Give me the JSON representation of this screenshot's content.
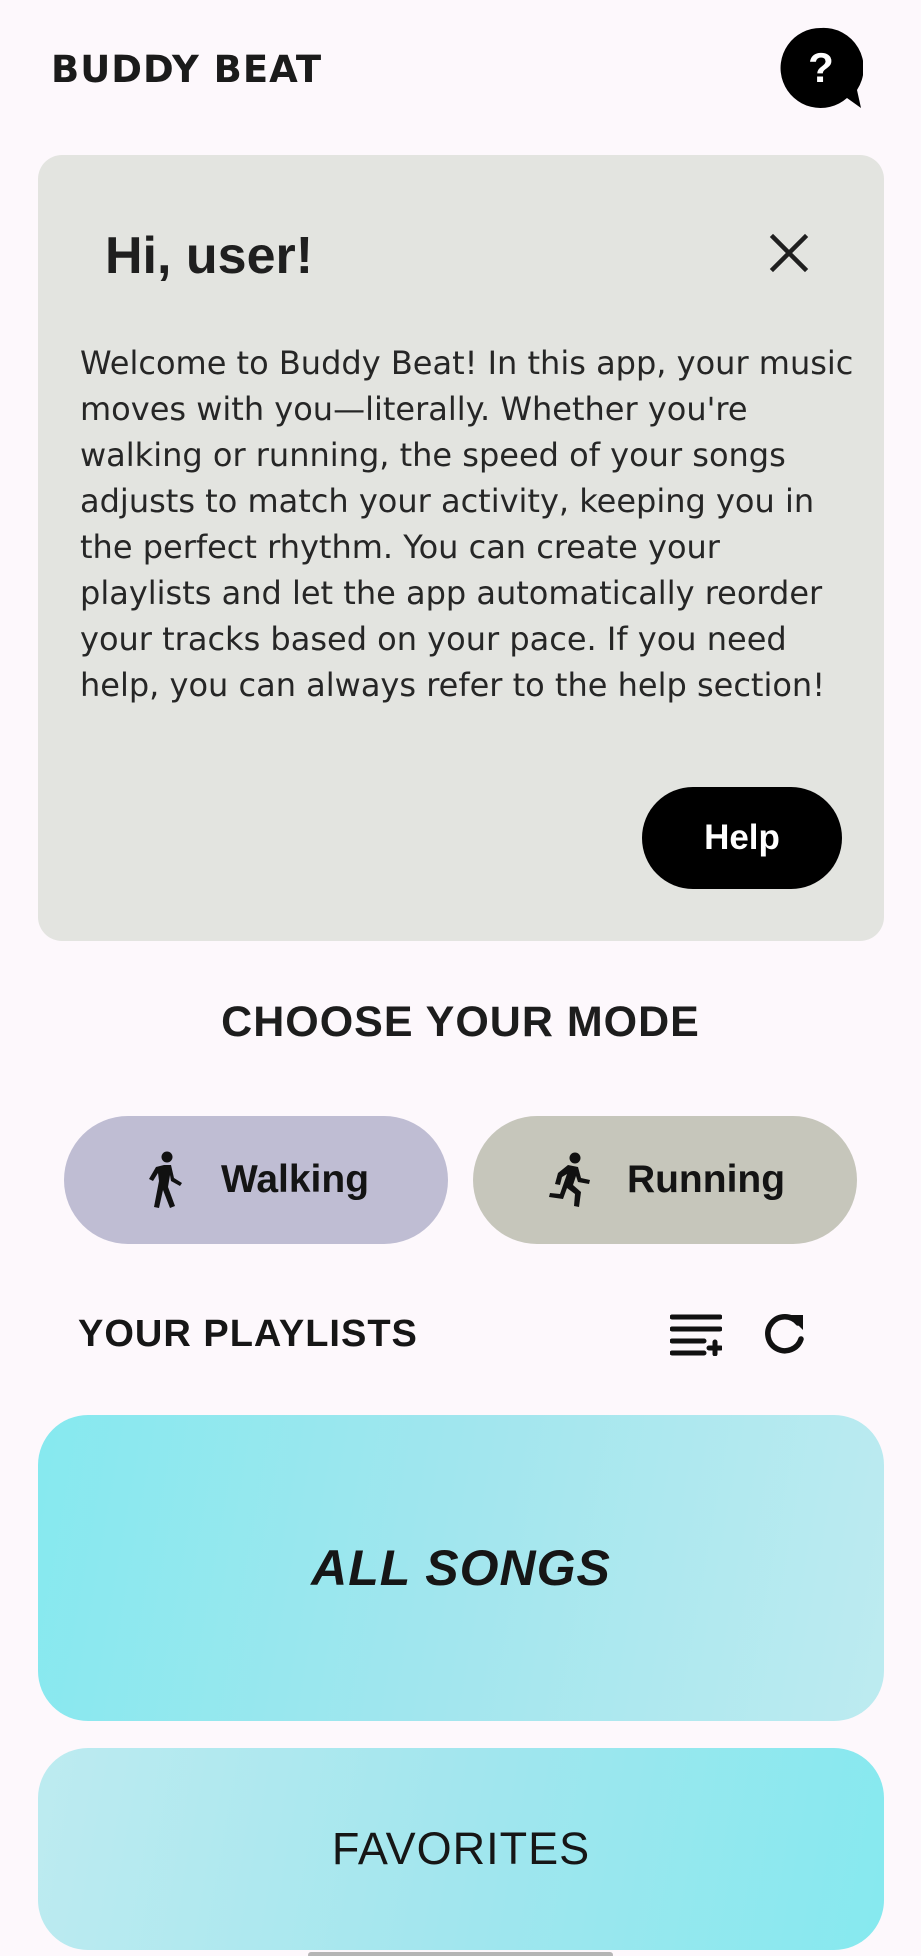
{
  "header": {
    "app_title": "BUDDY BEAT",
    "help_icon": "question-bubble-icon"
  },
  "welcome": {
    "title": "Hi, user!",
    "close_icon": "close-icon",
    "body": "Welcome to Buddy Beat! In this app, your music moves with you—literally. Whether you're walking or running, the speed of your songs adjusts to match your activity, keeping you in the perfect rhythm. You can create your playlists and let the app automatically reorder your tracks based on your pace. If you need help, you can always refer to the help section!",
    "help_button": "Help"
  },
  "mode": {
    "title": "CHOOSE YOUR MODE",
    "walking_label": "Walking",
    "walking_icon": "walking-icon",
    "running_label": "Running",
    "running_icon": "running-icon"
  },
  "playlists": {
    "title": "YOUR PLAYLISTS",
    "sort_icon": "playlist-sort-icon",
    "refresh_icon": "refresh-icon",
    "items": [
      {
        "label": "ALL SONGS"
      },
      {
        "label": "FAVORITES"
      }
    ]
  },
  "colors": {
    "background": "#fdf8fc",
    "card": "#e3e4e0",
    "walking": "#bfbdd3",
    "running": "#c6c6bb",
    "playlist_light": "#bdebf0",
    "playlist_strong": "#86e9ef"
  }
}
